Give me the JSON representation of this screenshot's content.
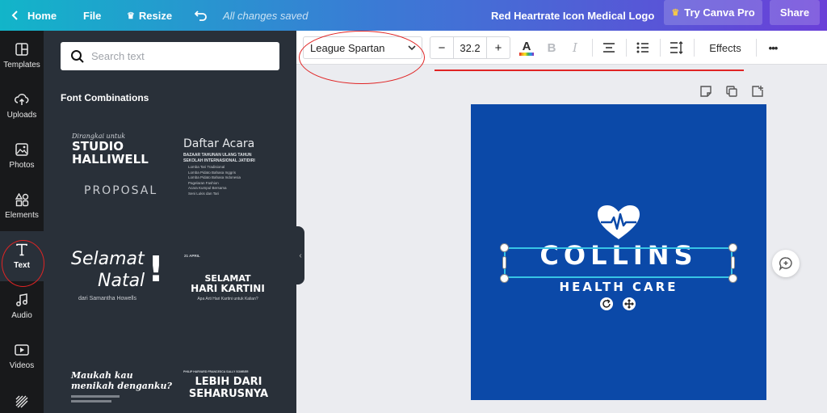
{
  "topbar": {
    "home": "Home",
    "file": "File",
    "resize": "Resize",
    "save_status": "All changes saved",
    "doc_title": "Red Heartrate Icon Medical Logo",
    "try_pro": "Try Canva Pro",
    "share": "Share"
  },
  "rail": {
    "templates": "Templates",
    "uploads": "Uploads",
    "photos": "Photos",
    "elements": "Elements",
    "text": "Text",
    "audio": "Audio",
    "videos": "Videos"
  },
  "panel": {
    "search_placeholder": "Search text",
    "heading": "Font Combinations",
    "combos": [
      {
        "line1": "Dirangkai untuk",
        "line2": "STUDIO",
        "line3": "HALLIWELL",
        "line4": "PROPOSAL"
      },
      {
        "title": "Daftar Acara",
        "sub": "BAZAAR TAHUNAN ULANG TAHUN SEKOLAH INTERNASIONAL JATIDIRI",
        "items": [
          "Lomba Tari Tradisional",
          "Lomba Pidato Bahasa Inggris",
          "Lomba Pidato Bahasa Indonesia",
          "Pagelaran Fashion",
          "Acara Kumpul Bersama",
          "Seni Lukis dan Tari"
        ]
      },
      {
        "line1": "Selamat",
        "line2": "Natal",
        "line3": "dari Samantha Howells"
      },
      {
        "date": "21 APRIL",
        "line1": "SELAMAT",
        "line2": "HARI KARTINI",
        "line3": "Apa Arti Hari Kartini untuk Kalian?"
      },
      {
        "line1": "Maukah kau",
        "line2": "menikah denganku?"
      },
      {
        "names": "PHILIP HARVARD   FRANCESCA   SALLY SOMBER",
        "line1": "LEBIH DARI",
        "line2": "SEHARUSNYA"
      }
    ]
  },
  "toolbar": {
    "font": "League Spartan",
    "size": "32.2",
    "minus": "−",
    "plus": "+",
    "bold": "B",
    "italic": "I",
    "effects": "Effects",
    "more": "•••"
  },
  "design": {
    "title": "COLLINS",
    "subtitle": "HEALTH CARE"
  },
  "colors": {
    "canvas_bg": "#0b49a8",
    "selection": "#37c4e6",
    "annotation": "#e02424",
    "panel_bg": "#293039"
  }
}
